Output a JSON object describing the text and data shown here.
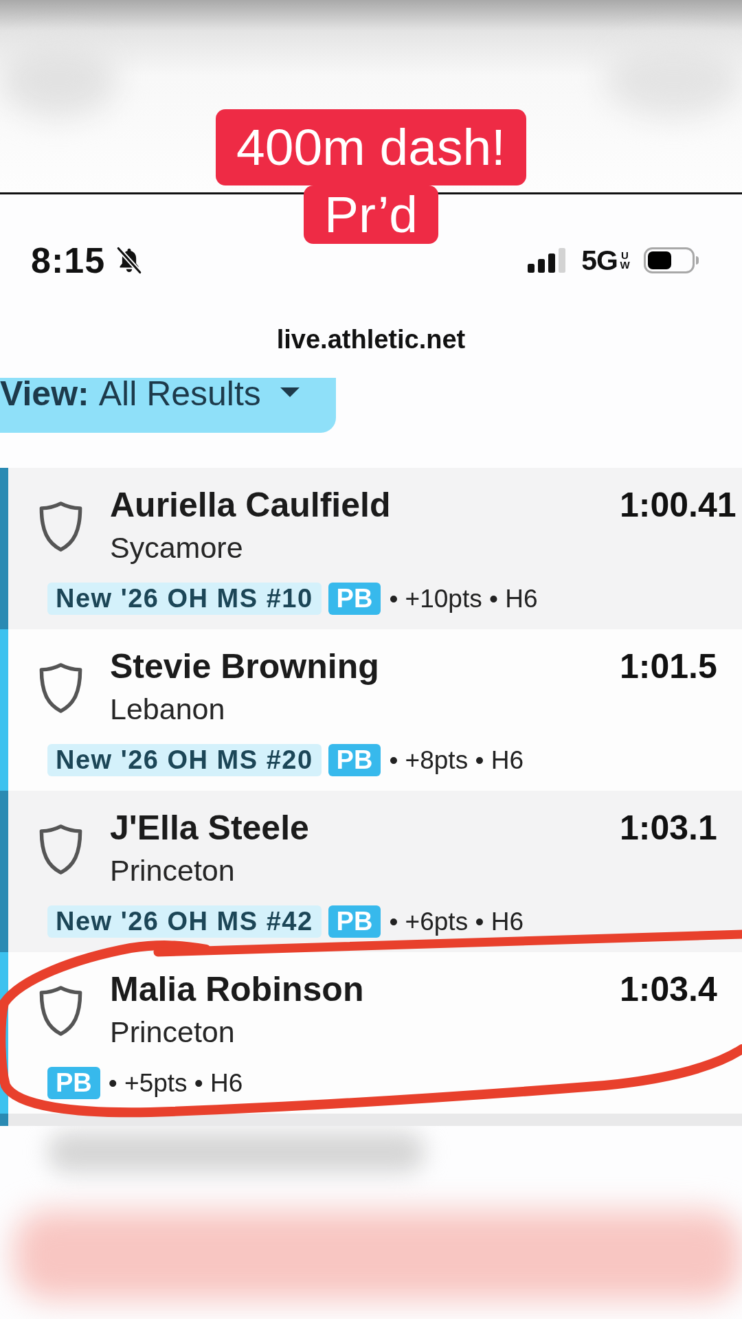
{
  "caption": {
    "lines": [
      "400m dash!",
      "Pr’d"
    ]
  },
  "status_bar": {
    "time": "8:15",
    "silent": true,
    "network": "5G",
    "network_suffix": "UW"
  },
  "browser": {
    "url": "live.athletic.net"
  },
  "view_filter": {
    "label": "View:",
    "value": "All Results"
  },
  "results": [
    {
      "name": "Auriella Caulfield",
      "school": "Sycamore",
      "time": "1:00.41",
      "badges": [
        {
          "kind": "record",
          "text": "New '26 OH MS #10"
        },
        {
          "kind": "pb",
          "text": "PB"
        }
      ],
      "details": "• +10pts • H6"
    },
    {
      "name": "Stevie Browning",
      "school": "Lebanon",
      "time": "1:01.5",
      "badges": [
        {
          "kind": "record",
          "text": "New '26 OH MS #20"
        },
        {
          "kind": "pb",
          "text": "PB"
        }
      ],
      "details": "• +8pts • H6"
    },
    {
      "name": "J'Ella Steele",
      "school": "Princeton",
      "time": "1:03.1",
      "badges": [
        {
          "kind": "record",
          "text": "New '26 OH MS #42"
        },
        {
          "kind": "pb",
          "text": "PB"
        }
      ],
      "details": "• +6pts • H6"
    },
    {
      "name": "Malia Robinson",
      "school": "Princeton",
      "time": "1:03.4",
      "badges": [
        {
          "kind": "pb",
          "text": "PB"
        }
      ],
      "details": "• +5pts • H6"
    }
  ]
}
